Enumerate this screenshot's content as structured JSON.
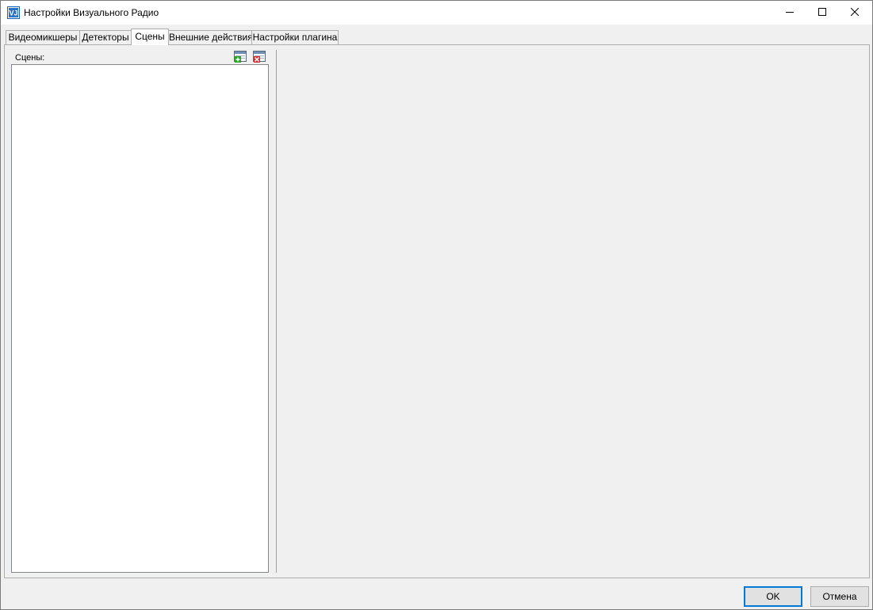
{
  "window": {
    "title": "Настройки Визуального Радио",
    "controls": {
      "minimize_icon": "minimize-icon",
      "maximize_icon": "maximize-icon",
      "close_icon": "close-icon"
    }
  },
  "tabs": [
    {
      "label": "Видеомикшеры",
      "active": false
    },
    {
      "label": "Детекторы",
      "active": false
    },
    {
      "label": "Сцены",
      "active": true
    },
    {
      "label": "Внешние действия",
      "active": false
    },
    {
      "label": "Настройки плагина",
      "active": false
    }
  ],
  "scenes_panel": {
    "label": "Сцены:",
    "add_icon": "add-scene-icon",
    "delete_icon": "delete-scene-icon",
    "items": []
  },
  "buttons": {
    "ok": "OK",
    "cancel": "Отмена"
  },
  "colors": {
    "accent": "#0078d7",
    "window_bg": "#f0f0f0",
    "list_bg": "#ffffff"
  }
}
